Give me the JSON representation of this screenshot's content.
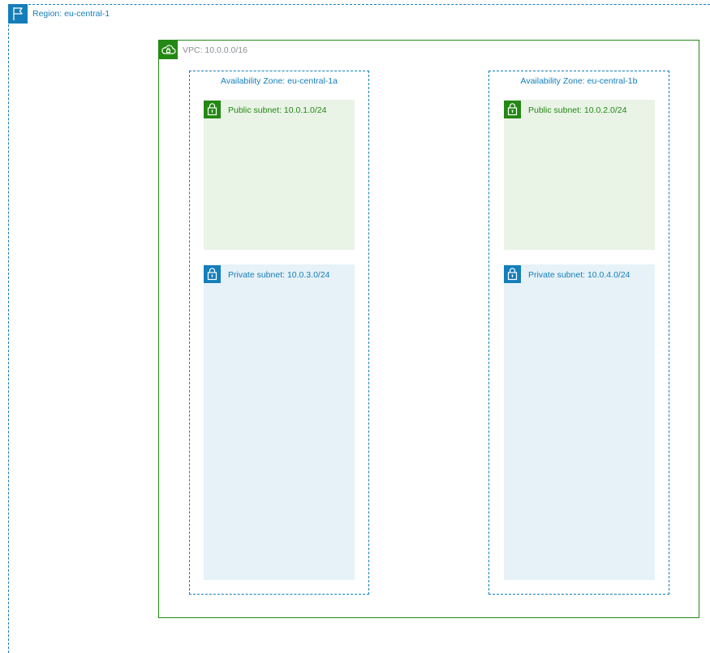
{
  "region": {
    "label": "Region: eu-central-1",
    "icon": "flag-icon",
    "color": "#147eba"
  },
  "vpc": {
    "label": "VPC: 10.0.0.0/16",
    "icon": "cloud-lock-icon",
    "color": "#248814"
  },
  "zones": [
    {
      "label": "Availability Zone: eu-central-1a",
      "public_subnet": "Public subnet: 10.0.1.0/24",
      "private_subnet": "Private subnet: 10.0.3.0/24"
    },
    {
      "label": "Availability Zone: eu-central-1b",
      "public_subnet": "Public subnet: 10.0.2.0/24",
      "private_subnet": "Private subnet: 10.0.4.0/24"
    }
  ],
  "colors": {
    "public_fill": "#e9f3e6",
    "private_fill": "#e6f2f8",
    "public_accent": "#248814",
    "private_accent": "#147eba"
  },
  "icons": {
    "subnet": "lock-icon"
  }
}
